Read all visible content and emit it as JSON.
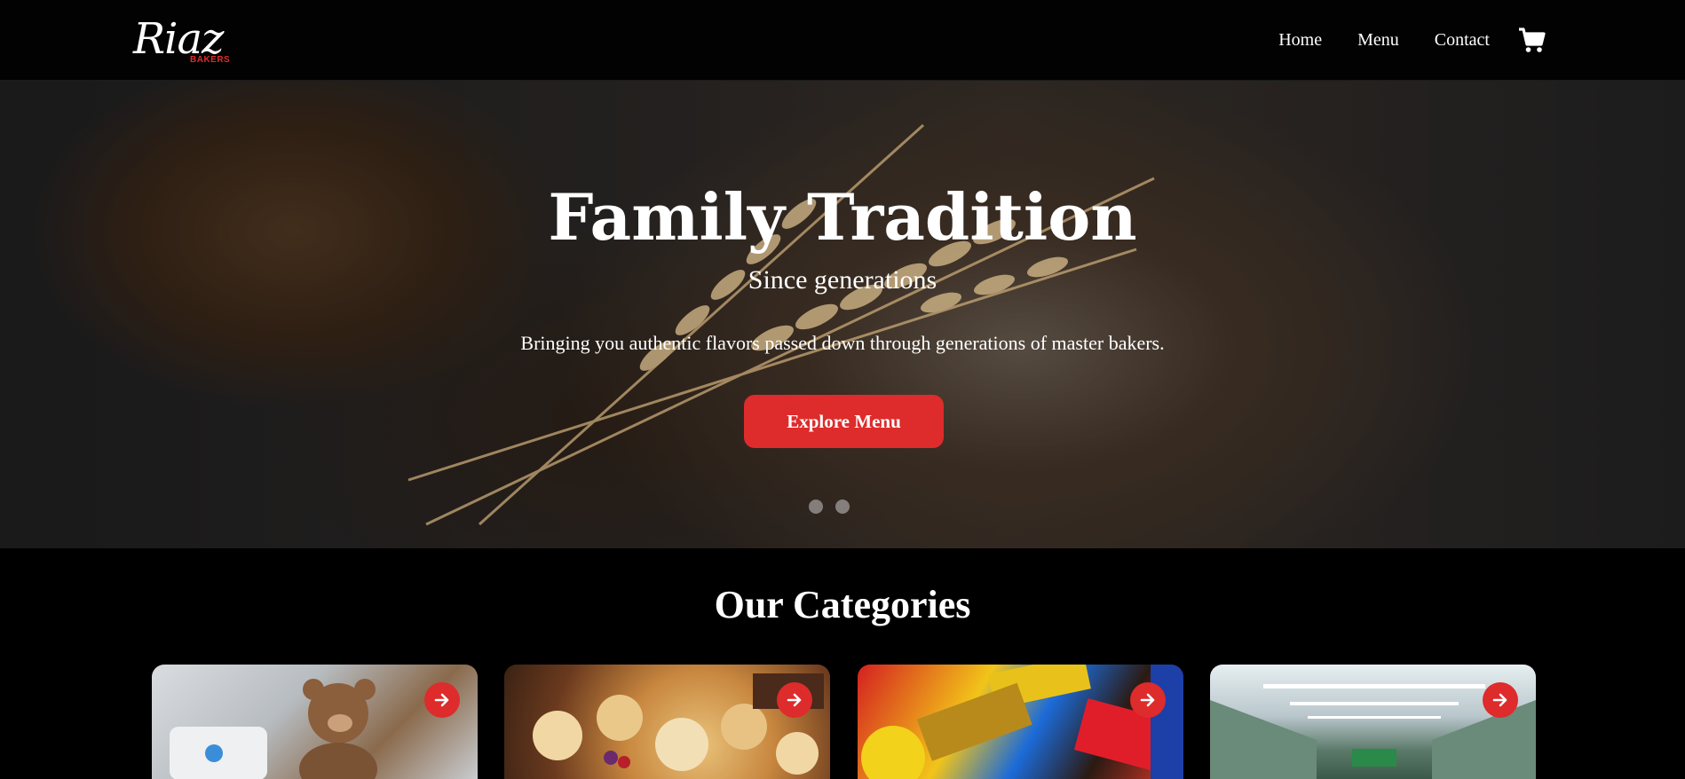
{
  "brand": {
    "logo_script": "Riaz",
    "logo_sub": "BAKERS"
  },
  "nav": {
    "items": [
      {
        "label": "Home"
      },
      {
        "label": "Menu"
      },
      {
        "label": "Contact"
      }
    ],
    "cart_icon": "shopping-cart-icon"
  },
  "hero": {
    "title": "Family Tradition",
    "subtitle": "Since generations",
    "description": "Bringing you authentic flavors passed down through generations of master bakers.",
    "cta_label": "Explore Menu",
    "slides": 2
  },
  "categories": {
    "title": "Our Categories",
    "cards": [
      {
        "image": "baby-items-teddy-bear-image",
        "icon": "arrow-right-icon"
      },
      {
        "image": "pastries-tarts-image",
        "icon": "arrow-right-icon"
      },
      {
        "image": "candy-chocolates-image",
        "icon": "arrow-right-icon"
      },
      {
        "image": "grocery-store-aisle-image",
        "icon": "arrow-right-icon"
      }
    ]
  },
  "colors": {
    "accent": "#de2b2b",
    "background": "#000000",
    "text": "#ffffff"
  }
}
